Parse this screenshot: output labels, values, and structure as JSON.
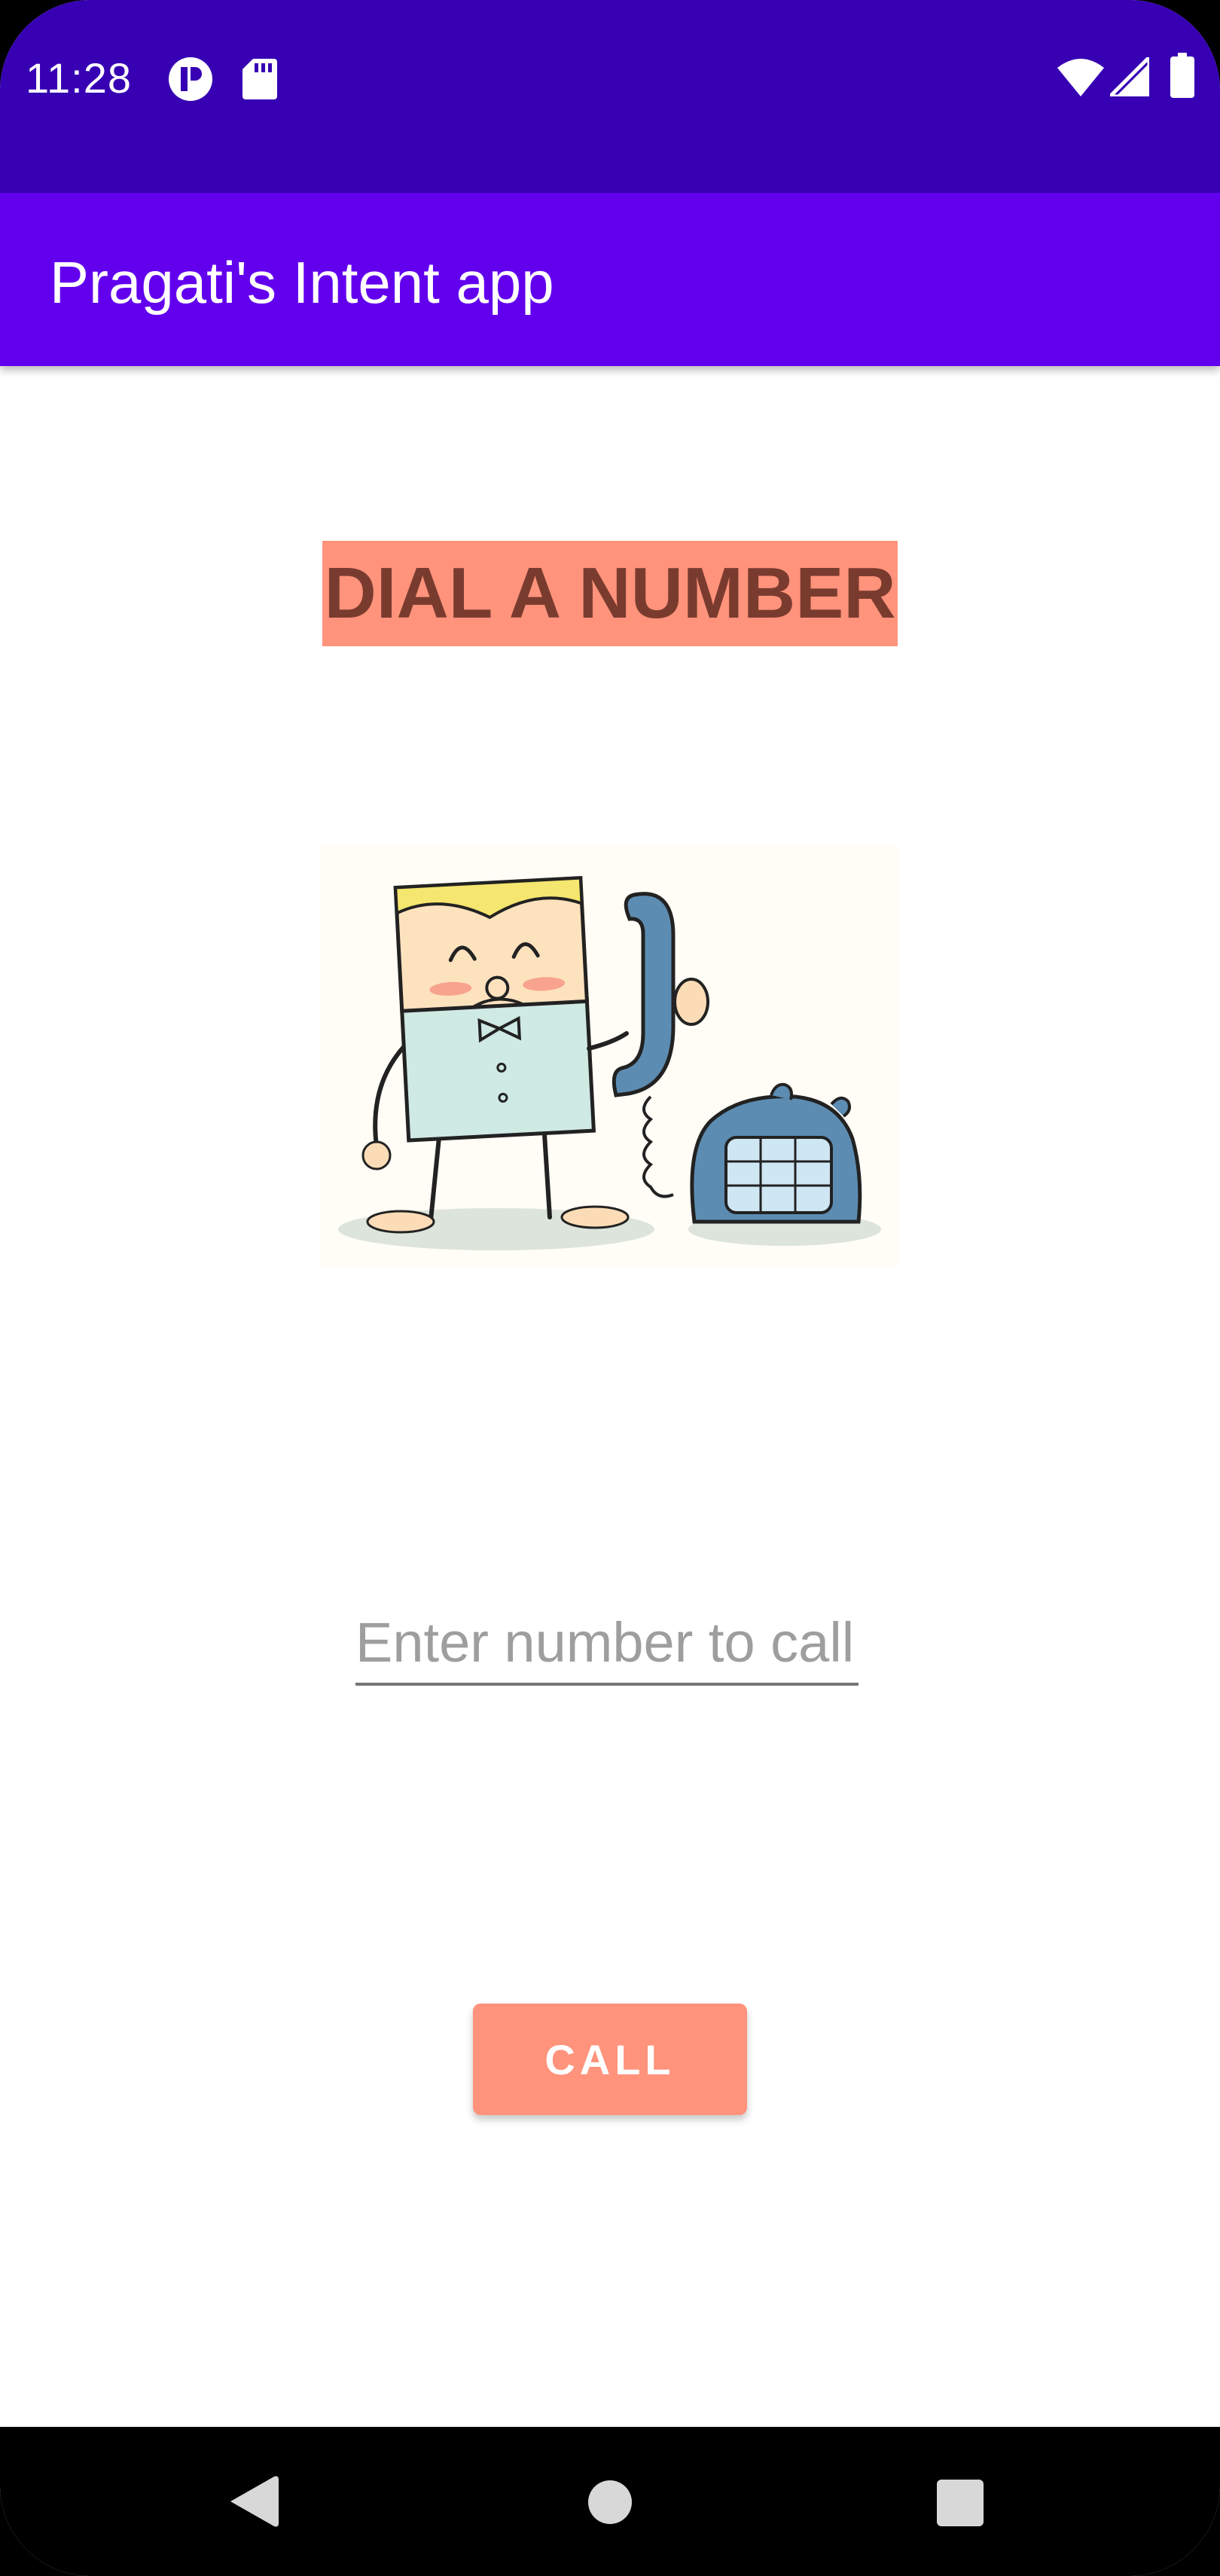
{
  "status_bar": {
    "time": "11:28",
    "color": "#3700b3",
    "left_icons": [
      "app-notification-icon",
      "sd-card-icon"
    ],
    "right_icons": [
      "wifi-icon",
      "cell-signal-icon",
      "battery-icon"
    ]
  },
  "app_bar": {
    "title": "Pragati's Intent app",
    "color": "#6200ee"
  },
  "main": {
    "heading": "DIAL A NUMBER",
    "heading_bg_color": "#ff937b",
    "heading_text_color": "#7a3b2f",
    "illustration": "cartoon-character-on-telephone",
    "number_input": {
      "placeholder": "Enter number to call",
      "value": ""
    },
    "call_button": {
      "label": "CALL",
      "color": "#ff937b"
    }
  },
  "nav_bar": {
    "buttons": [
      "back-icon",
      "home-icon",
      "recents-icon"
    ]
  }
}
